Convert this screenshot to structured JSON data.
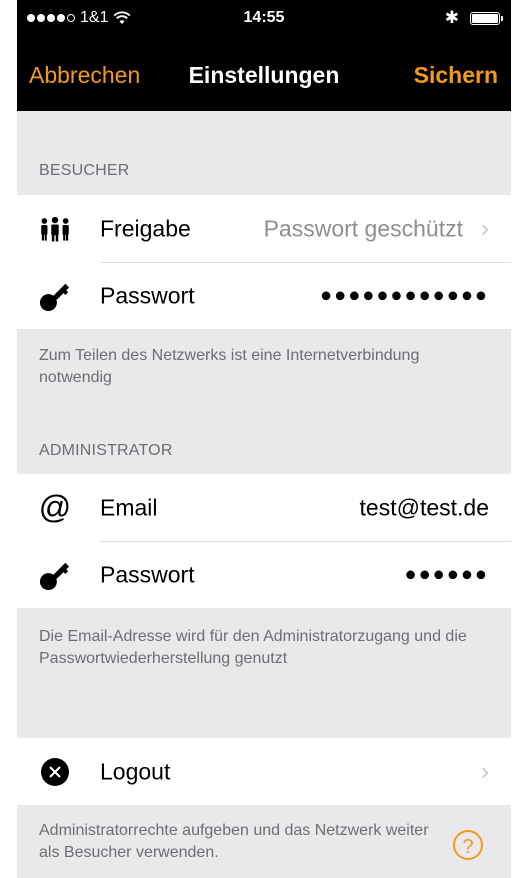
{
  "status_bar": {
    "carrier": "1&1",
    "time": "14:55",
    "bluetooth": "✱"
  },
  "nav": {
    "left": "Abbrechen",
    "title": "Einstellungen",
    "right": "Sichern"
  },
  "visitor": {
    "header": "BESUCHER",
    "share_label": "Freigabe",
    "share_value": "Passwort geschützt",
    "password_label": "Passwort",
    "password_value": "●●●●●●●●●●●●",
    "footer": "Zum Teilen des Netzwerks ist eine Internetverbindung notwendig"
  },
  "admin": {
    "header": "ADMINISTRATOR",
    "email_label": "Email",
    "email_value": "test@test.de",
    "password_label": "Passwort",
    "password_value": "●●●●●●",
    "footer": "Die Email-Adresse wird für den Administratorzugang und die Passwortwiederherstellung genutzt"
  },
  "logout": {
    "label": "Logout",
    "footer": "Administratorrechte aufgeben und das Netzwerk weiter als Besucher verwenden.",
    "help": "?"
  },
  "colors": {
    "accent": "#f39a1c",
    "background": "#e9e9ec",
    "nav": "#000000"
  }
}
